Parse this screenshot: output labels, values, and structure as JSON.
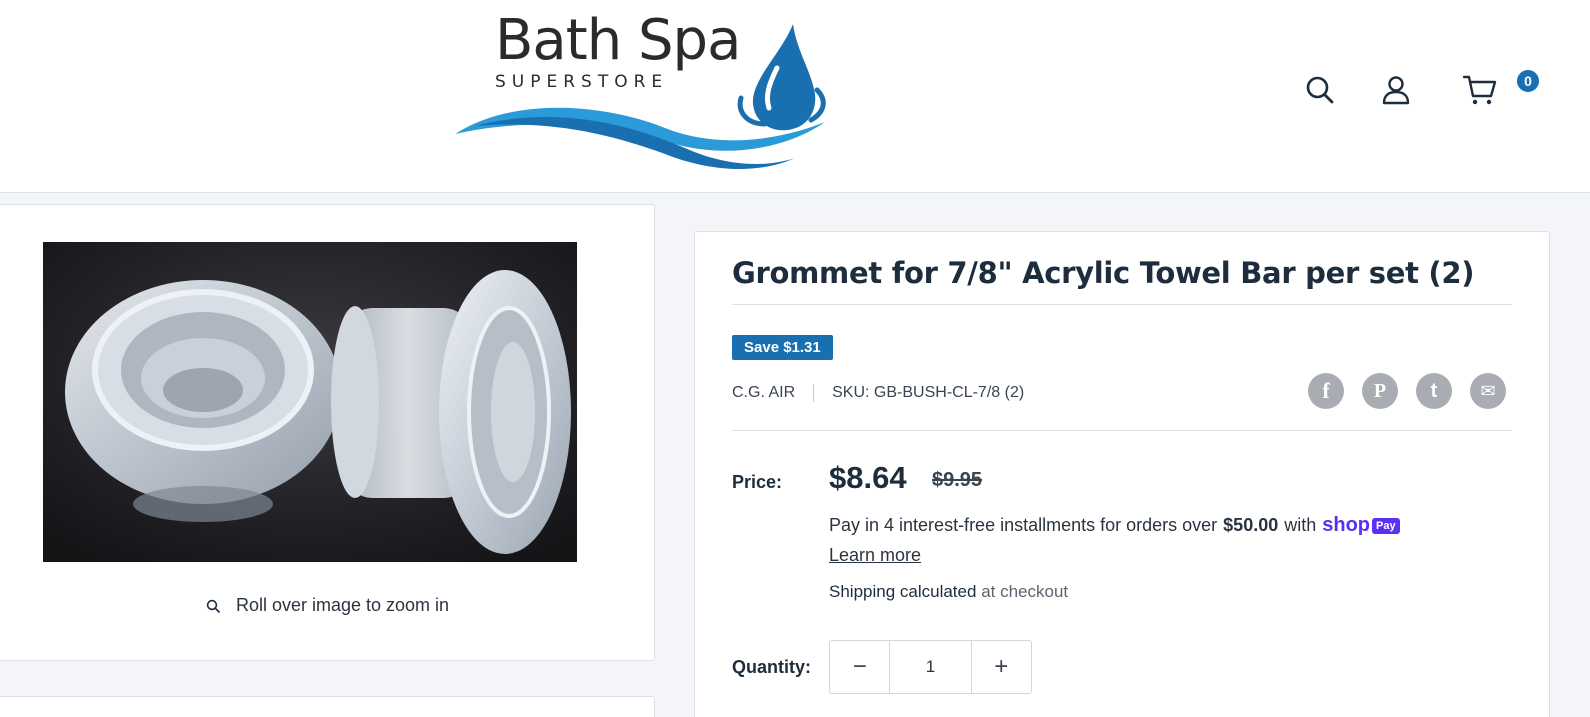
{
  "brand": {
    "name": "Bath Spa",
    "tagline": "SUPERSTORE"
  },
  "header": {
    "cart_count": "0"
  },
  "gallery": {
    "zoom_hint": "Roll over image to zoom in"
  },
  "product": {
    "title": "Grommet for 7/8\" Acrylic Towel Bar per set (2)",
    "save_badge": "Save $1.31",
    "vendor": "C.G. AIR",
    "sku": "SKU: GB-BUSH-CL-7/8 (2)",
    "price_label": "Price:",
    "price": "$8.64",
    "compare_price": "$9.95",
    "installments_text": "Pay in 4 interest-free installments for orders over",
    "installments_threshold": "$50.00",
    "installments_with": "with",
    "shop_pay_logo": "shop",
    "shop_pay_badge": "Pay",
    "learn_more": "Learn more",
    "shipping_calculated": "Shipping calculated",
    "shipping_at_checkout": "at checkout",
    "quantity_label": "Quantity:",
    "quantity_value": "1",
    "quantity_minus": "−",
    "quantity_plus": "+"
  },
  "share": {
    "facebook": "f",
    "pinterest": "P",
    "twitter": "t",
    "email": "✉"
  },
  "colors": {
    "accent": "#1a6fb0",
    "shop_pay": "#5a31f4",
    "share_grey": "#a9adb3"
  }
}
